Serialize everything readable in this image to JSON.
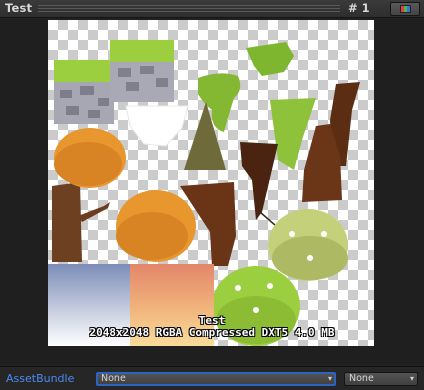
{
  "header": {
    "title": "Test",
    "mip_label": "# 1"
  },
  "preview": {
    "texture_name": "Test",
    "texture_info": "2048x2048 RGBA Compressed DXT5   4.0 MB"
  },
  "asset_bundle": {
    "label": "AssetBundle",
    "bundle_value": "None",
    "variant_value": "None"
  },
  "colors": {
    "accent": "#4a8bf0",
    "label_icon_bg": "#2f72d8",
    "grass": "#8ec23a",
    "orange": "#e8962e",
    "bark": "#5a3016"
  }
}
